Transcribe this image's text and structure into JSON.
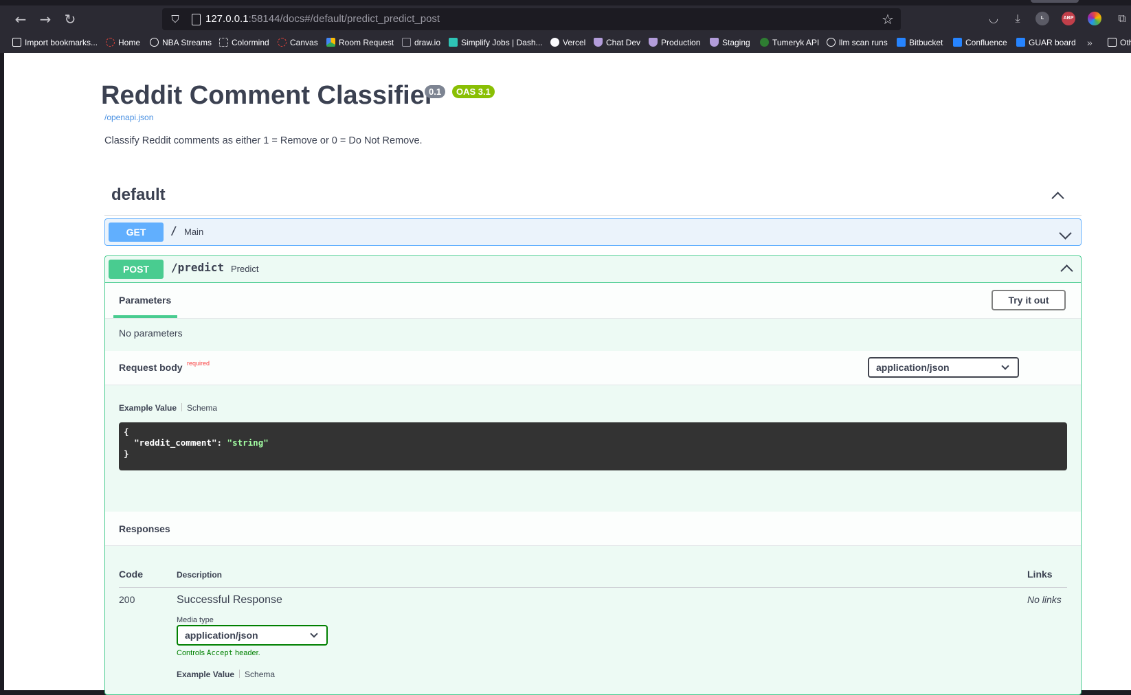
{
  "browser": {
    "url_host": "127.0.0.1",
    "url_rest": ":58144/docs#/default/predict_predict_post",
    "bookmarks": [
      {
        "label": "Import bookmarks...",
        "icon": "import-icon"
      },
      {
        "label": "Home",
        "icon": "home-icon",
        "color": "#e0443c"
      },
      {
        "label": "NBA Streams",
        "icon": "globe-icon"
      },
      {
        "label": "Colormind",
        "icon": "colormind-icon"
      },
      {
        "label": "Canvas",
        "icon": "canvas-icon",
        "color": "#e0443c"
      },
      {
        "label": "Room Request",
        "icon": "drive-icon"
      },
      {
        "label": "draw.io",
        "icon": "drawio-icon"
      },
      {
        "label": "Simplify Jobs | Dash...",
        "icon": "simplify-icon"
      },
      {
        "label": "Vercel",
        "icon": "vercel-icon"
      },
      {
        "label": "Chat Dev",
        "icon": "shield-icon"
      },
      {
        "label": "Production",
        "icon": "shield-icon"
      },
      {
        "label": "Staging",
        "icon": "shield-icon"
      },
      {
        "label": "Tumeryk API",
        "icon": "tumeryk-icon"
      },
      {
        "label": "llm scan runs",
        "icon": "globe-icon"
      },
      {
        "label": "Bitbucket",
        "icon": "bitbucket-icon",
        "color": "#2684ff"
      },
      {
        "label": "Confluence",
        "icon": "confluence-icon",
        "color": "#2684ff"
      },
      {
        "label": "GUAR board",
        "icon": "jira-icon",
        "color": "#2684ff"
      },
      {
        "label": "Oth",
        "icon": "folder-icon"
      }
    ],
    "ext_abp": "ABP",
    "ext_l": "L"
  },
  "info": {
    "title": "Reddit Comment Classifier",
    "version": "0.1",
    "oas": "OAS 3.1",
    "openapi_link": "/openapi.json",
    "description": "Classify Reddit comments as either 1 = Remove or 0 = Do Not Remove."
  },
  "tag": {
    "name": "default"
  },
  "operations": {
    "get": {
      "method": "GET",
      "path": "/",
      "summary": "Main"
    },
    "post": {
      "method": "POST",
      "path": "/predict",
      "summary": "Predict"
    }
  },
  "post_detail": {
    "parameters_tab": "Parameters",
    "try_it_out": "Try it out",
    "no_parameters": "No parameters",
    "request_body_label": "Request body",
    "required_label": "required",
    "content_type": "application/json",
    "example_value_tab": "Example Value",
    "schema_tab": "Schema",
    "code_open": "{",
    "code_key": "\"reddit_comment\"",
    "code_colon": ": ",
    "code_value": "\"string\"",
    "code_close": "}",
    "responses_title": "Responses",
    "columns": {
      "code": "Code",
      "description": "Description",
      "links": "Links"
    },
    "response": {
      "code": "200",
      "description": "Successful Response",
      "links": "No links",
      "media_type_label": "Media type",
      "media_type": "application/json",
      "controls_prefix": "Controls ",
      "controls_code": "Accept",
      "controls_suffix": " header."
    }
  }
}
